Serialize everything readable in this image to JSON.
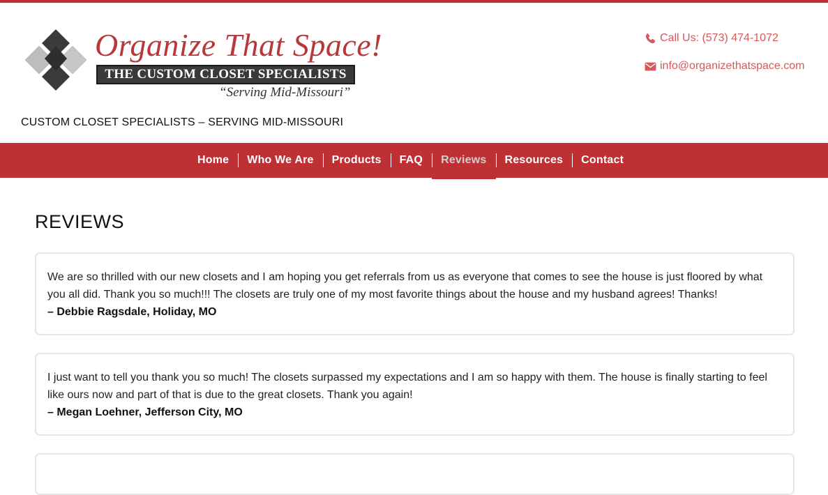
{
  "brand": {
    "title": "Organize That Space!",
    "banner": "THE CUSTOM CLOSET SPECIALISTS",
    "tagline_script": "“Serving Mid-Missouri”",
    "colors": {
      "accent": "#be3034",
      "contact": "#d6595a"
    }
  },
  "header": {
    "tagline": "CUSTOM CLOSET SPECIALISTS – SERVING MID-MISSOURI",
    "phone": {
      "icon": "phone-icon",
      "text": "Call Us: (573) 474-1072"
    },
    "email": {
      "icon": "envelope-icon",
      "text": "info@organizethatspace.com"
    }
  },
  "nav": {
    "items": [
      {
        "label": "Home"
      },
      {
        "label": "Who We Are"
      },
      {
        "label": "Products"
      },
      {
        "label": "FAQ"
      },
      {
        "label": "Reviews",
        "active": true
      },
      {
        "label": "Resources"
      },
      {
        "label": "Contact"
      }
    ]
  },
  "main": {
    "heading": "REVIEWS",
    "reviews": [
      {
        "text": "We are so thrilled with our new closets and I am hoping you get referrals from us as everyone that comes to see the house is just floored by what you all did.  Thank you so much!!!  The closets are truly one of my most favorite things about the house and my husband agrees! Thanks!",
        "author": "– Debbie Ragsdale, Holiday, MO"
      },
      {
        "text": "I just want to tell you thank you so much! The closets surpassed my expectations and I am so happy with them.  The house is finally starting to feel like ours now and part of that is due to the great closets.  Thank you again!",
        "author": "– Megan Loehner,  Jefferson City, MO"
      }
    ]
  }
}
